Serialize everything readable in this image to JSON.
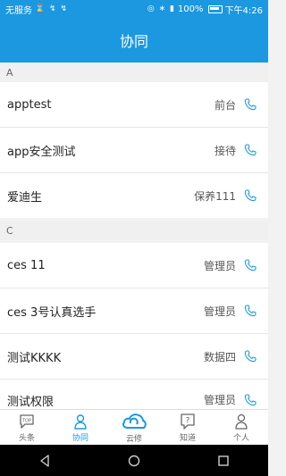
{
  "status": {
    "left": "无服务",
    "battery": "100%",
    "time": "下午4:26"
  },
  "title": "协同",
  "sections": [
    {
      "header": "A",
      "rows": [
        {
          "name": "apptest",
          "role": "前台"
        },
        {
          "name": "app安全测试",
          "role": "接待"
        },
        {
          "name": "爱迪生",
          "role": "保养111"
        }
      ]
    },
    {
      "header": "C",
      "rows": [
        {
          "name": "ces 11",
          "role": "管理员"
        },
        {
          "name": "ces 3号认真选手",
          "role": "管理员"
        },
        {
          "name": "测试KKKK",
          "role": "数据四"
        },
        {
          "name": "测试权限",
          "role": "管理员"
        }
      ]
    }
  ],
  "tabs": [
    {
      "label": "头条",
      "icon": "headline-icon",
      "active": false
    },
    {
      "label": "协同",
      "icon": "contacts-icon",
      "active": true
    },
    {
      "label": "云修",
      "icon": "cloud-icon",
      "active": false
    },
    {
      "label": "知道",
      "icon": "question-icon",
      "active": false
    },
    {
      "label": "个人",
      "icon": "person-icon",
      "active": false
    }
  ],
  "colors": {
    "accent": "#1b98e0"
  }
}
